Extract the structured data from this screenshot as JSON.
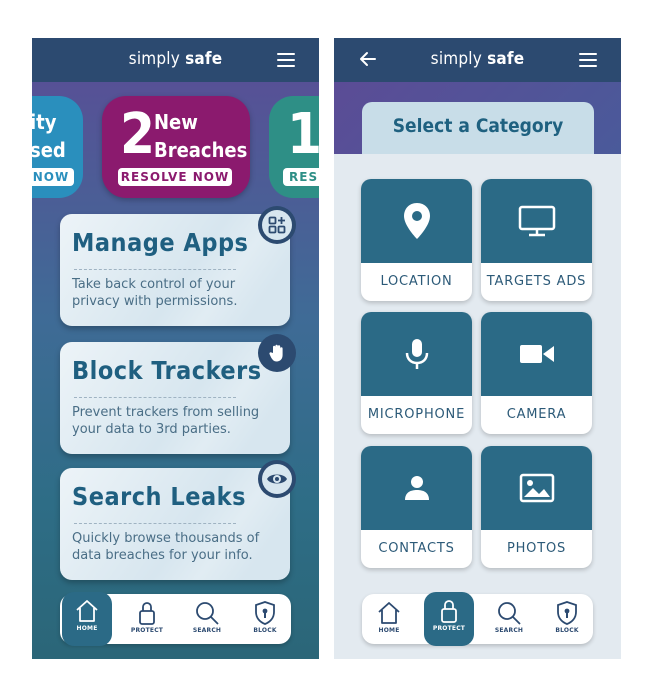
{
  "app": {
    "brand_regular": "simply ",
    "brand_bold": "safe"
  },
  "screen1": {
    "banners": [
      {
        "line1": "ity",
        "line2": "sed",
        "button": "NOW",
        "color": "#2a8fbd"
      },
      {
        "number": "2",
        "line1": "New",
        "line2": "Breaches",
        "button": "RESOLVE NOW",
        "color": "#8b1a6e"
      },
      {
        "number": "1",
        "button": "RES",
        "color": "#2e8f86"
      }
    ],
    "cards": [
      {
        "title": "Manage Apps",
        "description": "Take back control of your privacy with permissions.",
        "icon": "apps-grid-icon"
      },
      {
        "title": "Block Trackers",
        "description": "Prevent trackers from selling your data to 3rd parties.",
        "icon": "hand-stop-icon"
      },
      {
        "title": "Search Leaks",
        "description": "Quickly browse thousands of data breaches for your info.",
        "icon": "eye-icon"
      }
    ],
    "nav": {
      "home": "HOME",
      "protect": "PROTECT",
      "search": "SEARCH",
      "block": "BLOCK",
      "active": "home"
    }
  },
  "screen2": {
    "title": "Select a Category",
    "categories": [
      {
        "label": "LOCATION",
        "icon": "location-pin-icon"
      },
      {
        "label": "TARGETS ADS",
        "icon": "monitor-icon"
      },
      {
        "label": "MICROPHONE",
        "icon": "microphone-icon"
      },
      {
        "label": "CAMERA",
        "icon": "video-camera-icon"
      },
      {
        "label": "CONTACTS",
        "icon": "person-icon"
      },
      {
        "label": "PHOTOS",
        "icon": "image-icon"
      }
    ],
    "nav": {
      "home": "HOME",
      "protect": "PROTECT",
      "search": "SEARCH",
      "block": "BLOCK",
      "active": "protect"
    }
  },
  "colors": {
    "header": "#2c4a70",
    "accent_teal": "#2b6a86",
    "breach_magenta": "#8b1a6e"
  }
}
